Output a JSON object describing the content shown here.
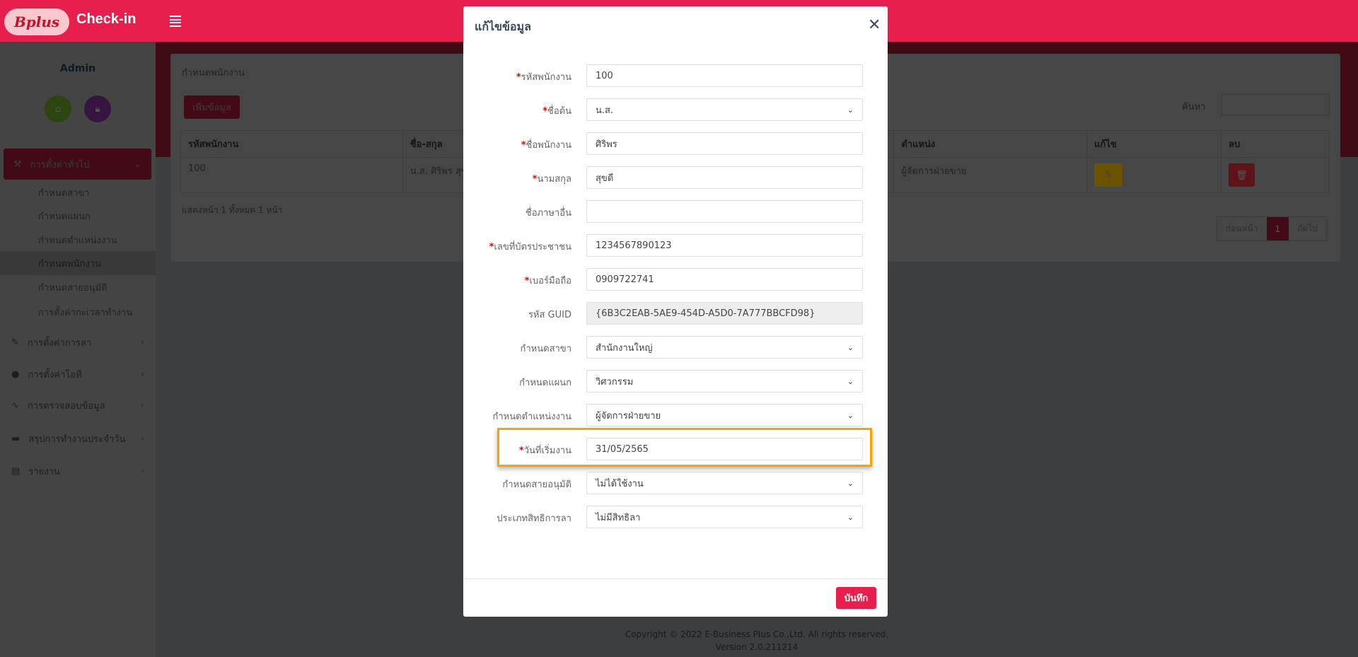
{
  "header": {
    "logo_text": "Bplus",
    "app_name": "Check-in",
    "colors": {
      "brand": "#e81e4c"
    }
  },
  "sidebar": {
    "user": "Admin",
    "quick": [
      {
        "icon": "home-icon",
        "color": "#6aa32c"
      },
      {
        "icon": "lock-icon",
        "color": "#7b2d8e"
      }
    ],
    "active_group": {
      "label": "การตั้งค่าทั่วไป",
      "icon": "tools-icon"
    },
    "sub_items": [
      "กำหนดสาขา",
      "กำหนดแผนก",
      "กำหนดตำแหน่งงาน",
      "กำหนดพนักงาน",
      "กำหนดสายอนุมัติ",
      "การตั้งค่ากะเวลาทำงาน"
    ],
    "active_sub": "กำหนดพนักงาน",
    "groups": [
      {
        "label": "การตั้งค่าการลา",
        "icon": "edit-icon"
      },
      {
        "label": "การตั้งค่าโอที",
        "icon": "clock-icon"
      },
      {
        "label": "การตรวจสอบข้อมูล",
        "icon": "pulse-icon"
      },
      {
        "label": "สรุปการทำงานประจำวัน",
        "icon": "calendar-icon"
      },
      {
        "label": "รายงาน",
        "icon": "file-icon"
      }
    ]
  },
  "main": {
    "title": "กำหนดพนักงาน",
    "add_label": "เพิ่มข้อมูล",
    "search_label": "ค้นหา",
    "columns": [
      "รหัสพนักงาน",
      "ชื่อ-สกุล",
      "ตำแหน่ง",
      "แก้ไข",
      "ลบ"
    ],
    "rows": [
      {
        "code": "100",
        "name": "น.ส. ศิริพร สุขดี",
        "position": "ผู้จัดการฝ่ายขาย"
      }
    ],
    "info": "แสดงหน้า 1 ทั้งหมด 1 หน้า",
    "pager": {
      "prev": "ก่อนหน้า",
      "current": "1",
      "next": "ถัดไป"
    }
  },
  "footer": {
    "copyright": "Copyright © 2022 E-Business Plus Co.,Ltd. All rights reserved.",
    "version": "Version 2.0.211214"
  },
  "modal": {
    "title": "แก้ไขข้อมูล",
    "save_label": "บันทึก",
    "fields": [
      {
        "label": "รหัสพนักงาน",
        "required": true,
        "type": "text",
        "value": "100"
      },
      {
        "label": "ชื่อต้น",
        "required": true,
        "type": "select",
        "value": "น.ส."
      },
      {
        "label": "ชื่อพนักงาน",
        "required": true,
        "type": "text",
        "value": "ศิริพร"
      },
      {
        "label": "นามสกุล",
        "required": true,
        "type": "text",
        "value": "สุขดี"
      },
      {
        "label": "ชื่อภาษาอื่น",
        "required": false,
        "type": "text",
        "value": ""
      },
      {
        "label": "เลขที่บัตรประชาชน",
        "required": true,
        "type": "text",
        "value": "1234567890123"
      },
      {
        "label": "เบอร์มือถือ",
        "required": true,
        "type": "text",
        "value": "0909722741"
      },
      {
        "label": "รหัส GUID",
        "required": false,
        "type": "disabled",
        "value": "{6B3C2EAB-5AE9-454D-A5D0-7A777BBCFD98}"
      },
      {
        "label": "กำหนดสาขา",
        "required": false,
        "type": "select",
        "value": "สำนักงานใหญ่"
      },
      {
        "label": "กำหนดแผนก",
        "required": false,
        "type": "select",
        "value": "วิศวกรรม"
      },
      {
        "label": "กำหนดตำแหน่งงาน",
        "required": false,
        "type": "select",
        "value": "ผู้จัดการฝ่ายขาย"
      },
      {
        "label": "วันที่เริ่มงาน",
        "required": true,
        "type": "text",
        "value": "31/05/2565",
        "highlighted": true
      },
      {
        "label": "กำหนดสายอนุมัติ",
        "required": false,
        "type": "select",
        "value": "ไม่ได้ใช้งาน"
      },
      {
        "label": "ประเภทสิทธิการลา",
        "required": false,
        "type": "select",
        "value": "ไม่มีสิทธิลา"
      }
    ],
    "highlight_color": "#f5a500"
  }
}
